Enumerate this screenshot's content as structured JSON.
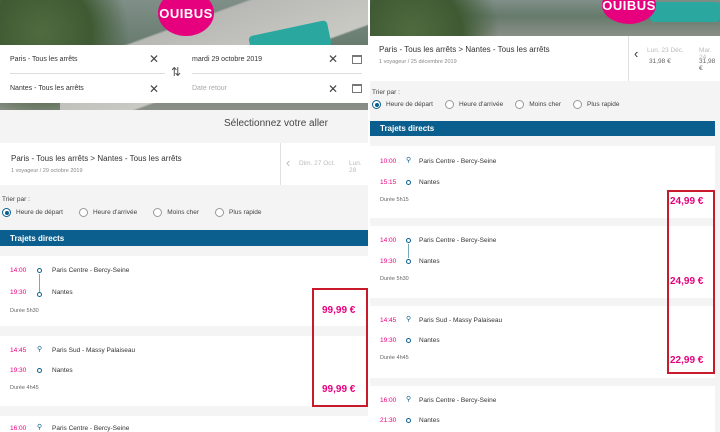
{
  "brand": {
    "logo_text": "OUIBUS",
    "accent": "#e6007e",
    "primary": "#0b5f8e",
    "highlight": "#c81a2a"
  },
  "left": {
    "search": {
      "from": "Paris - Tous les arrêts",
      "to": "Nantes - Tous les arrêts",
      "depart_date": "mardi 29 octobre 2019",
      "return_placeholder": "Date retour"
    },
    "select_title": "Sélectionnez votre aller",
    "summary": {
      "route": "Paris - Tous les arrêts > Nantes - Tous les arrêts",
      "sub": "1 voyageur / 29 octobre 2019",
      "date_prev": "Dim. 27 Oct.",
      "date_next": "Lun. 28"
    },
    "sort": {
      "label": "Trier par :",
      "options": [
        "Heure de départ",
        "Heure d'arrivée",
        "Moins cher",
        "Plus rapide"
      ],
      "selected": 0
    },
    "section": "Trajets directs",
    "trips": [
      {
        "dep": "14:00",
        "from": "Paris Centre - Bercy-Seine",
        "arr": "19:30",
        "to": "Nantes",
        "duration": "Durée 5h30",
        "price": "99,99 €"
      },
      {
        "dep": "14:45",
        "from": "Paris Sud - Massy Palaiseau",
        "arr": "19:30",
        "to": "Nantes",
        "duration": "Durée 4h45",
        "price": "99,99 €"
      },
      {
        "dep": "16:00",
        "from": "Paris Centre - Bercy-Seine"
      }
    ]
  },
  "right": {
    "summary": {
      "route": "Paris - Tous les arrêts > Nantes - Tous les arrêts",
      "sub": "1 voyageur / 25 décembre 2019",
      "date_prev": "Lun. 23 Déc.",
      "date_prev_price": "31,98 €",
      "date_next": "Mar. 24",
      "date_next_price": "31,98 €"
    },
    "sort": {
      "label": "Trier par :",
      "options": [
        "Heure de départ",
        "Heure d'arrivée",
        "Moins cher",
        "Plus rapide"
      ],
      "selected": 0
    },
    "section": "Trajets directs",
    "trips": [
      {
        "dep": "10:00",
        "from": "Paris Centre - Bercy-Seine",
        "arr": "15:15",
        "to": "Nantes",
        "duration": "Durée 5h15",
        "price": "24,99 €"
      },
      {
        "dep": "14:00",
        "from": "Paris Centre - Bercy-Seine",
        "arr": "19:30",
        "to": "Nantes",
        "duration": "Durée 5h30",
        "price": "24,99 €"
      },
      {
        "dep": "14:45",
        "from": "Paris Sud - Massy Palaiseau",
        "arr": "19:30",
        "to": "Nantes",
        "duration": "Durée 4h45",
        "price": "22,99 €"
      },
      {
        "dep": "16:00",
        "from": "Paris Centre - Bercy-Seine",
        "arr": "21:30",
        "to": "Nantes"
      }
    ]
  }
}
